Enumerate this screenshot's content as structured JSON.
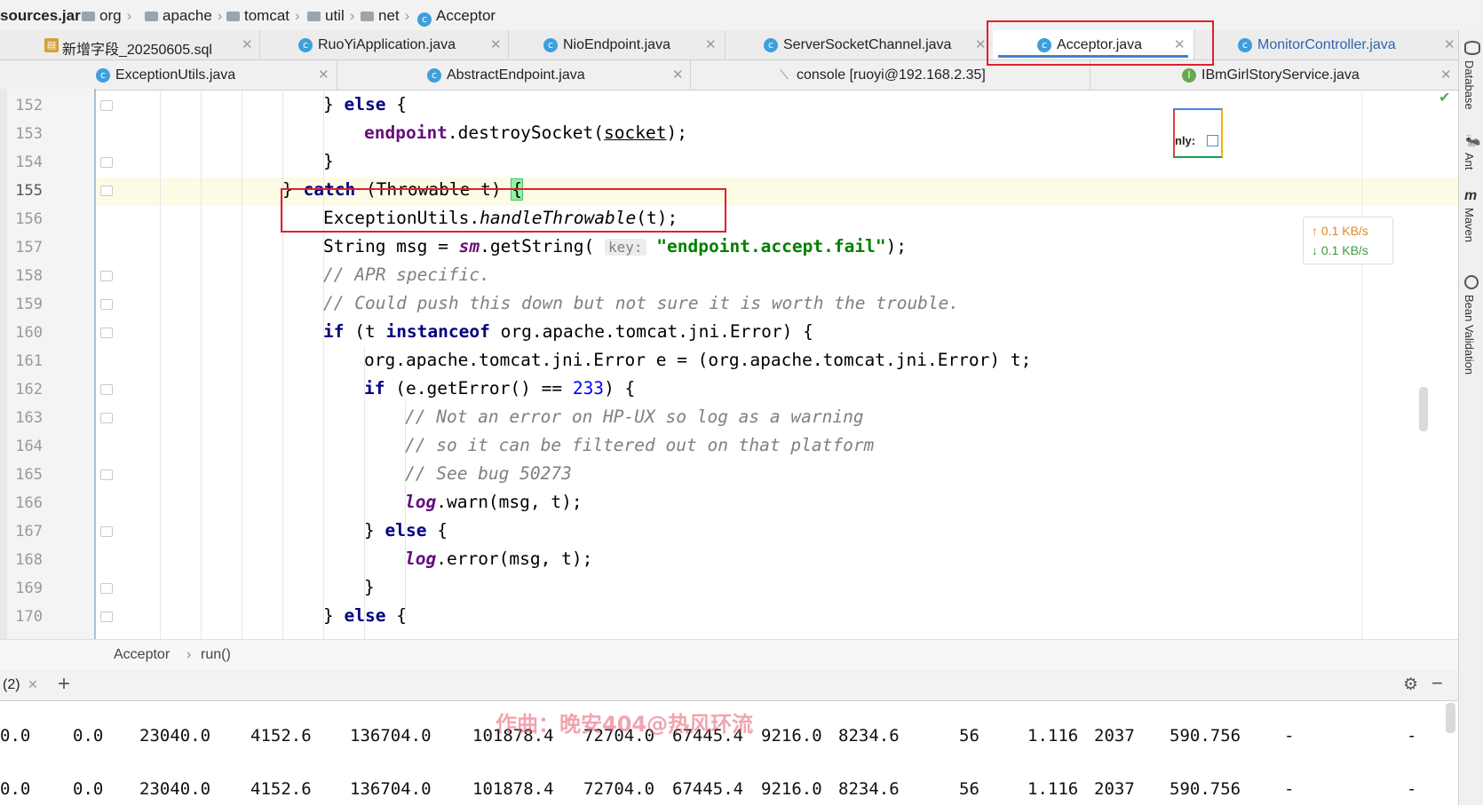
{
  "breadcrumb": {
    "jar": "sources.jar",
    "segments": [
      "org",
      "apache",
      "tomcat",
      "util",
      "net"
    ],
    "class_name": "Acceptor"
  },
  "tabs_row1": [
    {
      "label": "新增字段_20250605.sql",
      "icon": "sql-file-icon"
    },
    {
      "label": "RuoYiApplication.java",
      "icon": "class-icon"
    },
    {
      "label": "NioEndpoint.java",
      "icon": "class-icon"
    },
    {
      "label": "ServerSocketChannel.java",
      "icon": "class-icon"
    },
    {
      "label": "Acceptor.java",
      "icon": "class-icon",
      "active": true
    },
    {
      "label": "MonitorController.java",
      "icon": "class-icon"
    }
  ],
  "tabs_row2": [
    {
      "label": "ExceptionUtils.java",
      "icon": "class-icon"
    },
    {
      "label": "AbstractEndpoint.java",
      "icon": "class-icon"
    },
    {
      "label": "console [ruoyi@192.168.2.35]",
      "icon": "console-icon"
    },
    {
      "label": "IBmGirlStoryService.java",
      "icon": "interface-icon"
    }
  ],
  "tool_windows": [
    "Database",
    "Ant",
    "Maven",
    "Bean Validation"
  ],
  "line_numbers": [
    "152",
    "153",
    "154",
    "155",
    "156",
    "157",
    "158",
    "159",
    "160",
    "161",
    "162",
    "163",
    "164",
    "165",
    "166",
    "167",
    "168",
    "169",
    "170"
  ],
  "code": {
    "l152_else": "else",
    "l153_field": "endpoint",
    "l153_call": ".destroySocket(",
    "l153_arg": "socket",
    "l153_end": ");",
    "l155_catch": "catch",
    "l155_rest": "(Throwable t)",
    "l156_cls": "ExceptionUtils.",
    "l156_method": "handleThrowable",
    "l156_end": "(t);",
    "l157_decl": "String msg = ",
    "l157_sm": "sm",
    "l157_call": ".getString(",
    "l157_hint": "key:",
    "l157_str": "\"endpoint.accept.fail\"",
    "l157_end": ");",
    "l158": "// APR specific.",
    "l159": "// Could push this down but not sure it is worth the trouble.",
    "l160_if": "if",
    "l160_instanceof": "instanceof",
    "l160_type": "org.apache.tomcat.jni.Error) {",
    "l161": "org.apache.tomcat.jni.Error e = (org.apache.tomcat.jni.Error) t;",
    "l162_if": "if",
    "l162_cond": "(e.getError() == ",
    "l162_num": "233",
    "l162_end": ") {",
    "l163": "// Not an error on HP-UX so log as a warning",
    "l164": "// so it can be filtered out on that platform",
    "l165": "// See bug 50273",
    "l166_log": "log",
    "l166_rest": ".warn(msg, t);",
    "l167_else": "else",
    "l168_log": "log",
    "l168_rest": ".error(msg, t);",
    "l170_else": "else"
  },
  "popup_label": "nly:",
  "network": {
    "up": "0.1 KB/s",
    "down": "0.1 KB/s"
  },
  "editor_breadcrumb": {
    "cls": "Acceptor",
    "method": "run()"
  },
  "bottom": {
    "session_label": "(2)",
    "add": "+"
  },
  "watermark": "作曲：晚安404@热风环流",
  "console_rows": [
    [
      "0.0",
      "0.0",
      "23040.0",
      "4152.6",
      "136704.0",
      "101878.4",
      "72704.0",
      "67445.4",
      "9216.0",
      "8234.6",
      "56",
      "1.116",
      "2037",
      "590.756",
      "-",
      "-"
    ],
    [
      "0.0",
      "0.0",
      "23040.0",
      "4152.6",
      "136704.0",
      "101878.4",
      "72704.0",
      "67445.4",
      "9216.0",
      "8234.6",
      "56",
      "1.116",
      "2037",
      "590.756",
      "-",
      "-"
    ]
  ]
}
